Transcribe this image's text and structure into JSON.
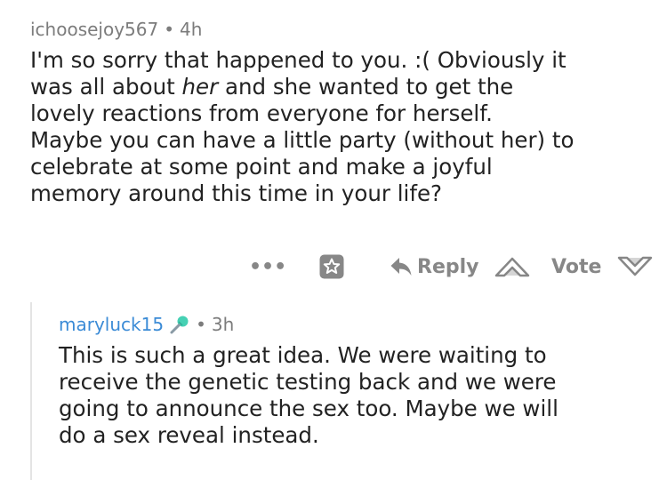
{
  "comment": {
    "username": "ichoosejoy567",
    "separator": "•",
    "age": "4h",
    "lines": [
      "I'm so sorry that happened to you. :( Obviously it",
      "was all about ",
      "her",
      " and she wanted to get the",
      "lovely reactions from everyone for herself.",
      "Maybe you can have a little party (without her) to",
      "celebrate at some point and make a joyful",
      "memory around this time in your life?"
    ]
  },
  "actions": {
    "more": "•••",
    "reply_label": "Reply",
    "vote_label": "Vote"
  },
  "reply": {
    "username": "maryluck15",
    "separator": "•",
    "age": "3h",
    "lines": [
      "This is such a great idea. We were waiting to",
      "receive the genetic testing back and we were",
      "going to announce the sex too. Maybe we will",
      "do a sex reveal instead."
    ]
  },
  "colors": {
    "username_reply": "#3b8bd6",
    "meta_gray": "#7c7c7c",
    "action_gray": "#878787",
    "mic_teal": "#46d1b4"
  },
  "icons": {
    "save": "star-in-box-icon",
    "reply": "reply-arrow-icon",
    "upvote": "upvote-arrow-icon",
    "downvote": "downvote-arrow-icon",
    "mic": "microphone-icon"
  }
}
